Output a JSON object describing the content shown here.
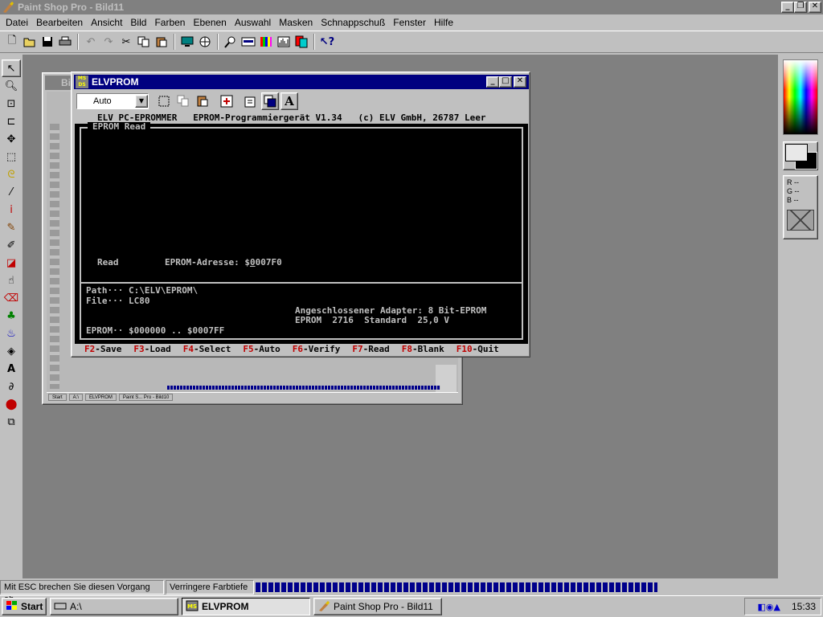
{
  "psp": {
    "title": "Paint Shop Pro - Bild11",
    "menu": [
      "Datei",
      "Bearbeiten",
      "Ansicht",
      "Bild",
      "Farben",
      "Ebenen",
      "Auswahl",
      "Masken",
      "Schnappschuß",
      "Fenster",
      "Hilfe"
    ],
    "rgb": {
      "r": "R --",
      "g": "G --",
      "b": "B --"
    }
  },
  "status": {
    "left": "Mit ESC brechen Sie diesen Vorgang ab",
    "middle": "Verringere Farbtiefe"
  },
  "taskbar": {
    "start": "Start",
    "tasks": [
      "A:\\",
      "ELVPROM",
      "Paint Shop Pro - Bild11"
    ],
    "clock": "15:33"
  },
  "mini": {
    "title": "Bi",
    "tasks": [
      "Start",
      "A:\\",
      "ELVPROM",
      "Paint S... Pro - Bild10"
    ]
  },
  "elv": {
    "title": "ELVPROM",
    "icon_text": "MS DS",
    "combo_value": "Auto",
    "screen": {
      "header": "ELV PC-EPROMMER   EPROM-Programmiergerät V1.34   (c) ELV GmbH, 26787 Leer",
      "frame_title": "EPROM Read",
      "read_label": "Read",
      "addr_label": "EPROM-Adresse: $",
      "addr_cursor": "0",
      "addr_rest": "007F0",
      "path": "Path··· C:\\ELV\\EPROM\\",
      "file": "File··· LC80",
      "adapter": "Angeschlossener Adapter: 8 Bit-EPROM",
      "eprom_info": "EPROM  2716  Standard  25,0 V",
      "range": "EPROM·· $000000 .. $0007FF"
    },
    "fkeys": [
      {
        "key": "F2",
        "label": "-Save"
      },
      {
        "key": "F3",
        "label": "-Load"
      },
      {
        "key": "F4",
        "label": "-Select"
      },
      {
        "key": "F5",
        "label": "-Auto"
      },
      {
        "key": "F6",
        "label": "-Verify"
      },
      {
        "key": "F7",
        "label": "-Read"
      },
      {
        "key": "F8",
        "label": "-Blank"
      },
      {
        "key": "F10",
        "label": "-Quit"
      }
    ]
  }
}
